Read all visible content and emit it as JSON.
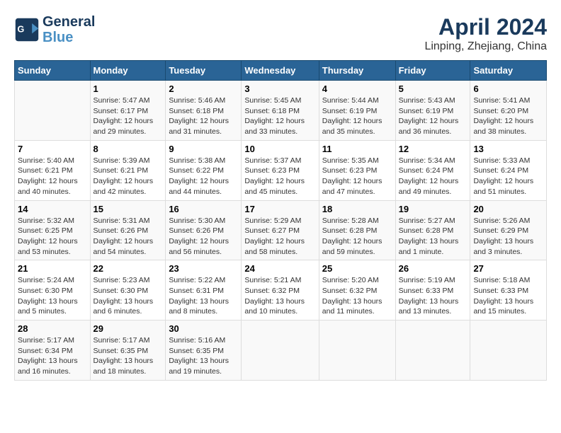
{
  "header": {
    "logo_line1": "General",
    "logo_line2": "Blue",
    "month": "April 2024",
    "location": "Linping, Zhejiang, China"
  },
  "weekdays": [
    "Sunday",
    "Monday",
    "Tuesday",
    "Wednesday",
    "Thursday",
    "Friday",
    "Saturday"
  ],
  "weeks": [
    [
      {
        "day": "",
        "info": ""
      },
      {
        "day": "1",
        "info": "Sunrise: 5:47 AM\nSunset: 6:17 PM\nDaylight: 12 hours\nand 29 minutes."
      },
      {
        "day": "2",
        "info": "Sunrise: 5:46 AM\nSunset: 6:18 PM\nDaylight: 12 hours\nand 31 minutes."
      },
      {
        "day": "3",
        "info": "Sunrise: 5:45 AM\nSunset: 6:18 PM\nDaylight: 12 hours\nand 33 minutes."
      },
      {
        "day": "4",
        "info": "Sunrise: 5:44 AM\nSunset: 6:19 PM\nDaylight: 12 hours\nand 35 minutes."
      },
      {
        "day": "5",
        "info": "Sunrise: 5:43 AM\nSunset: 6:19 PM\nDaylight: 12 hours\nand 36 minutes."
      },
      {
        "day": "6",
        "info": "Sunrise: 5:41 AM\nSunset: 6:20 PM\nDaylight: 12 hours\nand 38 minutes."
      }
    ],
    [
      {
        "day": "7",
        "info": "Sunrise: 5:40 AM\nSunset: 6:21 PM\nDaylight: 12 hours\nand 40 minutes."
      },
      {
        "day": "8",
        "info": "Sunrise: 5:39 AM\nSunset: 6:21 PM\nDaylight: 12 hours\nand 42 minutes."
      },
      {
        "day": "9",
        "info": "Sunrise: 5:38 AM\nSunset: 6:22 PM\nDaylight: 12 hours\nand 44 minutes."
      },
      {
        "day": "10",
        "info": "Sunrise: 5:37 AM\nSunset: 6:23 PM\nDaylight: 12 hours\nand 45 minutes."
      },
      {
        "day": "11",
        "info": "Sunrise: 5:35 AM\nSunset: 6:23 PM\nDaylight: 12 hours\nand 47 minutes."
      },
      {
        "day": "12",
        "info": "Sunrise: 5:34 AM\nSunset: 6:24 PM\nDaylight: 12 hours\nand 49 minutes."
      },
      {
        "day": "13",
        "info": "Sunrise: 5:33 AM\nSunset: 6:24 PM\nDaylight: 12 hours\nand 51 minutes."
      }
    ],
    [
      {
        "day": "14",
        "info": "Sunrise: 5:32 AM\nSunset: 6:25 PM\nDaylight: 12 hours\nand 53 minutes."
      },
      {
        "day": "15",
        "info": "Sunrise: 5:31 AM\nSunset: 6:26 PM\nDaylight: 12 hours\nand 54 minutes."
      },
      {
        "day": "16",
        "info": "Sunrise: 5:30 AM\nSunset: 6:26 PM\nDaylight: 12 hours\nand 56 minutes."
      },
      {
        "day": "17",
        "info": "Sunrise: 5:29 AM\nSunset: 6:27 PM\nDaylight: 12 hours\nand 58 minutes."
      },
      {
        "day": "18",
        "info": "Sunrise: 5:28 AM\nSunset: 6:28 PM\nDaylight: 12 hours\nand 59 minutes."
      },
      {
        "day": "19",
        "info": "Sunrise: 5:27 AM\nSunset: 6:28 PM\nDaylight: 13 hours\nand 1 minute."
      },
      {
        "day": "20",
        "info": "Sunrise: 5:26 AM\nSunset: 6:29 PM\nDaylight: 13 hours\nand 3 minutes."
      }
    ],
    [
      {
        "day": "21",
        "info": "Sunrise: 5:24 AM\nSunset: 6:30 PM\nDaylight: 13 hours\nand 5 minutes."
      },
      {
        "day": "22",
        "info": "Sunrise: 5:23 AM\nSunset: 6:30 PM\nDaylight: 13 hours\nand 6 minutes."
      },
      {
        "day": "23",
        "info": "Sunrise: 5:22 AM\nSunset: 6:31 PM\nDaylight: 13 hours\nand 8 minutes."
      },
      {
        "day": "24",
        "info": "Sunrise: 5:21 AM\nSunset: 6:32 PM\nDaylight: 13 hours\nand 10 minutes."
      },
      {
        "day": "25",
        "info": "Sunrise: 5:20 AM\nSunset: 6:32 PM\nDaylight: 13 hours\nand 11 minutes."
      },
      {
        "day": "26",
        "info": "Sunrise: 5:19 AM\nSunset: 6:33 PM\nDaylight: 13 hours\nand 13 minutes."
      },
      {
        "day": "27",
        "info": "Sunrise: 5:18 AM\nSunset: 6:33 PM\nDaylight: 13 hours\nand 15 minutes."
      }
    ],
    [
      {
        "day": "28",
        "info": "Sunrise: 5:17 AM\nSunset: 6:34 PM\nDaylight: 13 hours\nand 16 minutes."
      },
      {
        "day": "29",
        "info": "Sunrise: 5:17 AM\nSunset: 6:35 PM\nDaylight: 13 hours\nand 18 minutes."
      },
      {
        "day": "30",
        "info": "Sunrise: 5:16 AM\nSunset: 6:35 PM\nDaylight: 13 hours\nand 19 minutes."
      },
      {
        "day": "",
        "info": ""
      },
      {
        "day": "",
        "info": ""
      },
      {
        "day": "",
        "info": ""
      },
      {
        "day": "",
        "info": ""
      }
    ]
  ]
}
